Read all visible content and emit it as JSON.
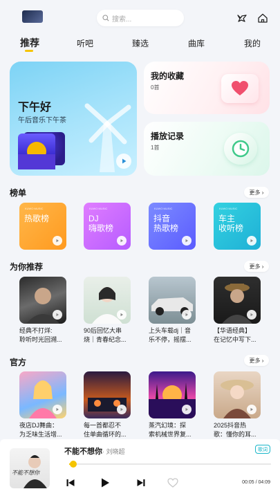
{
  "topbar": {
    "search_placeholder": "搜索..."
  },
  "tabs": [
    "推荐",
    "听吧",
    "臻选",
    "曲库",
    "我的"
  ],
  "hero": {
    "title": "下午好",
    "subtitle": "午后音乐下午茶"
  },
  "favorites": {
    "title": "我的收藏",
    "count": "0首"
  },
  "history": {
    "title": "播放记录",
    "count": "1首"
  },
  "sections": {
    "charts": {
      "title": "榜单",
      "more": "更多"
    },
    "recommend": {
      "title": "为你推荐",
      "more": "更多"
    },
    "official": {
      "title": "官方",
      "more": "更多"
    }
  },
  "charts": [
    {
      "label": "热歌榜",
      "mini": "KUWO MUSIC",
      "color_a": "#ffb74a",
      "color_b": "#ff9a1f"
    },
    {
      "label": "DJ\n嗨歌榜",
      "mini": "KUWO MUSIC",
      "color_a": "#e07dff",
      "color_b": "#b65cff"
    },
    {
      "label": "抖音\n热歌榜",
      "mini": "KUWO MUSIC",
      "color_a": "#7c8bff",
      "color_b": "#5b5cff"
    },
    {
      "label": "车主\n收听榜",
      "mini": "KUWO MUSIC",
      "color_a": "#33d1e0",
      "color_b": "#1fb0d6"
    }
  ],
  "recommend": [
    {
      "caption": "经典不打烊:\n聆听时光回溯..."
    },
    {
      "caption": "90后回忆大串\n烧｜青春纪念..."
    },
    {
      "caption": "上头车载dj｜音\n乐不停，摇摆..."
    },
    {
      "caption": "【华语经典】\n在记忆中写下..."
    }
  ],
  "official": [
    {
      "caption": "夜店DJ舞曲：\n为乏味生活增..."
    },
    {
      "caption": "每一首都忍不\n住单曲循环的..."
    },
    {
      "caption": "蒸汽幻境：探\n索机械世界复..."
    },
    {
      "caption": "2025抖音热\n歌：懂你的耳..."
    }
  ],
  "player": {
    "title": "不能不想你",
    "artist": "· 刘晓超",
    "lyric_label": "歌词",
    "time": "00:05 / 04:09",
    "progress": 0.02,
    "cover_text": "不能不想你"
  }
}
